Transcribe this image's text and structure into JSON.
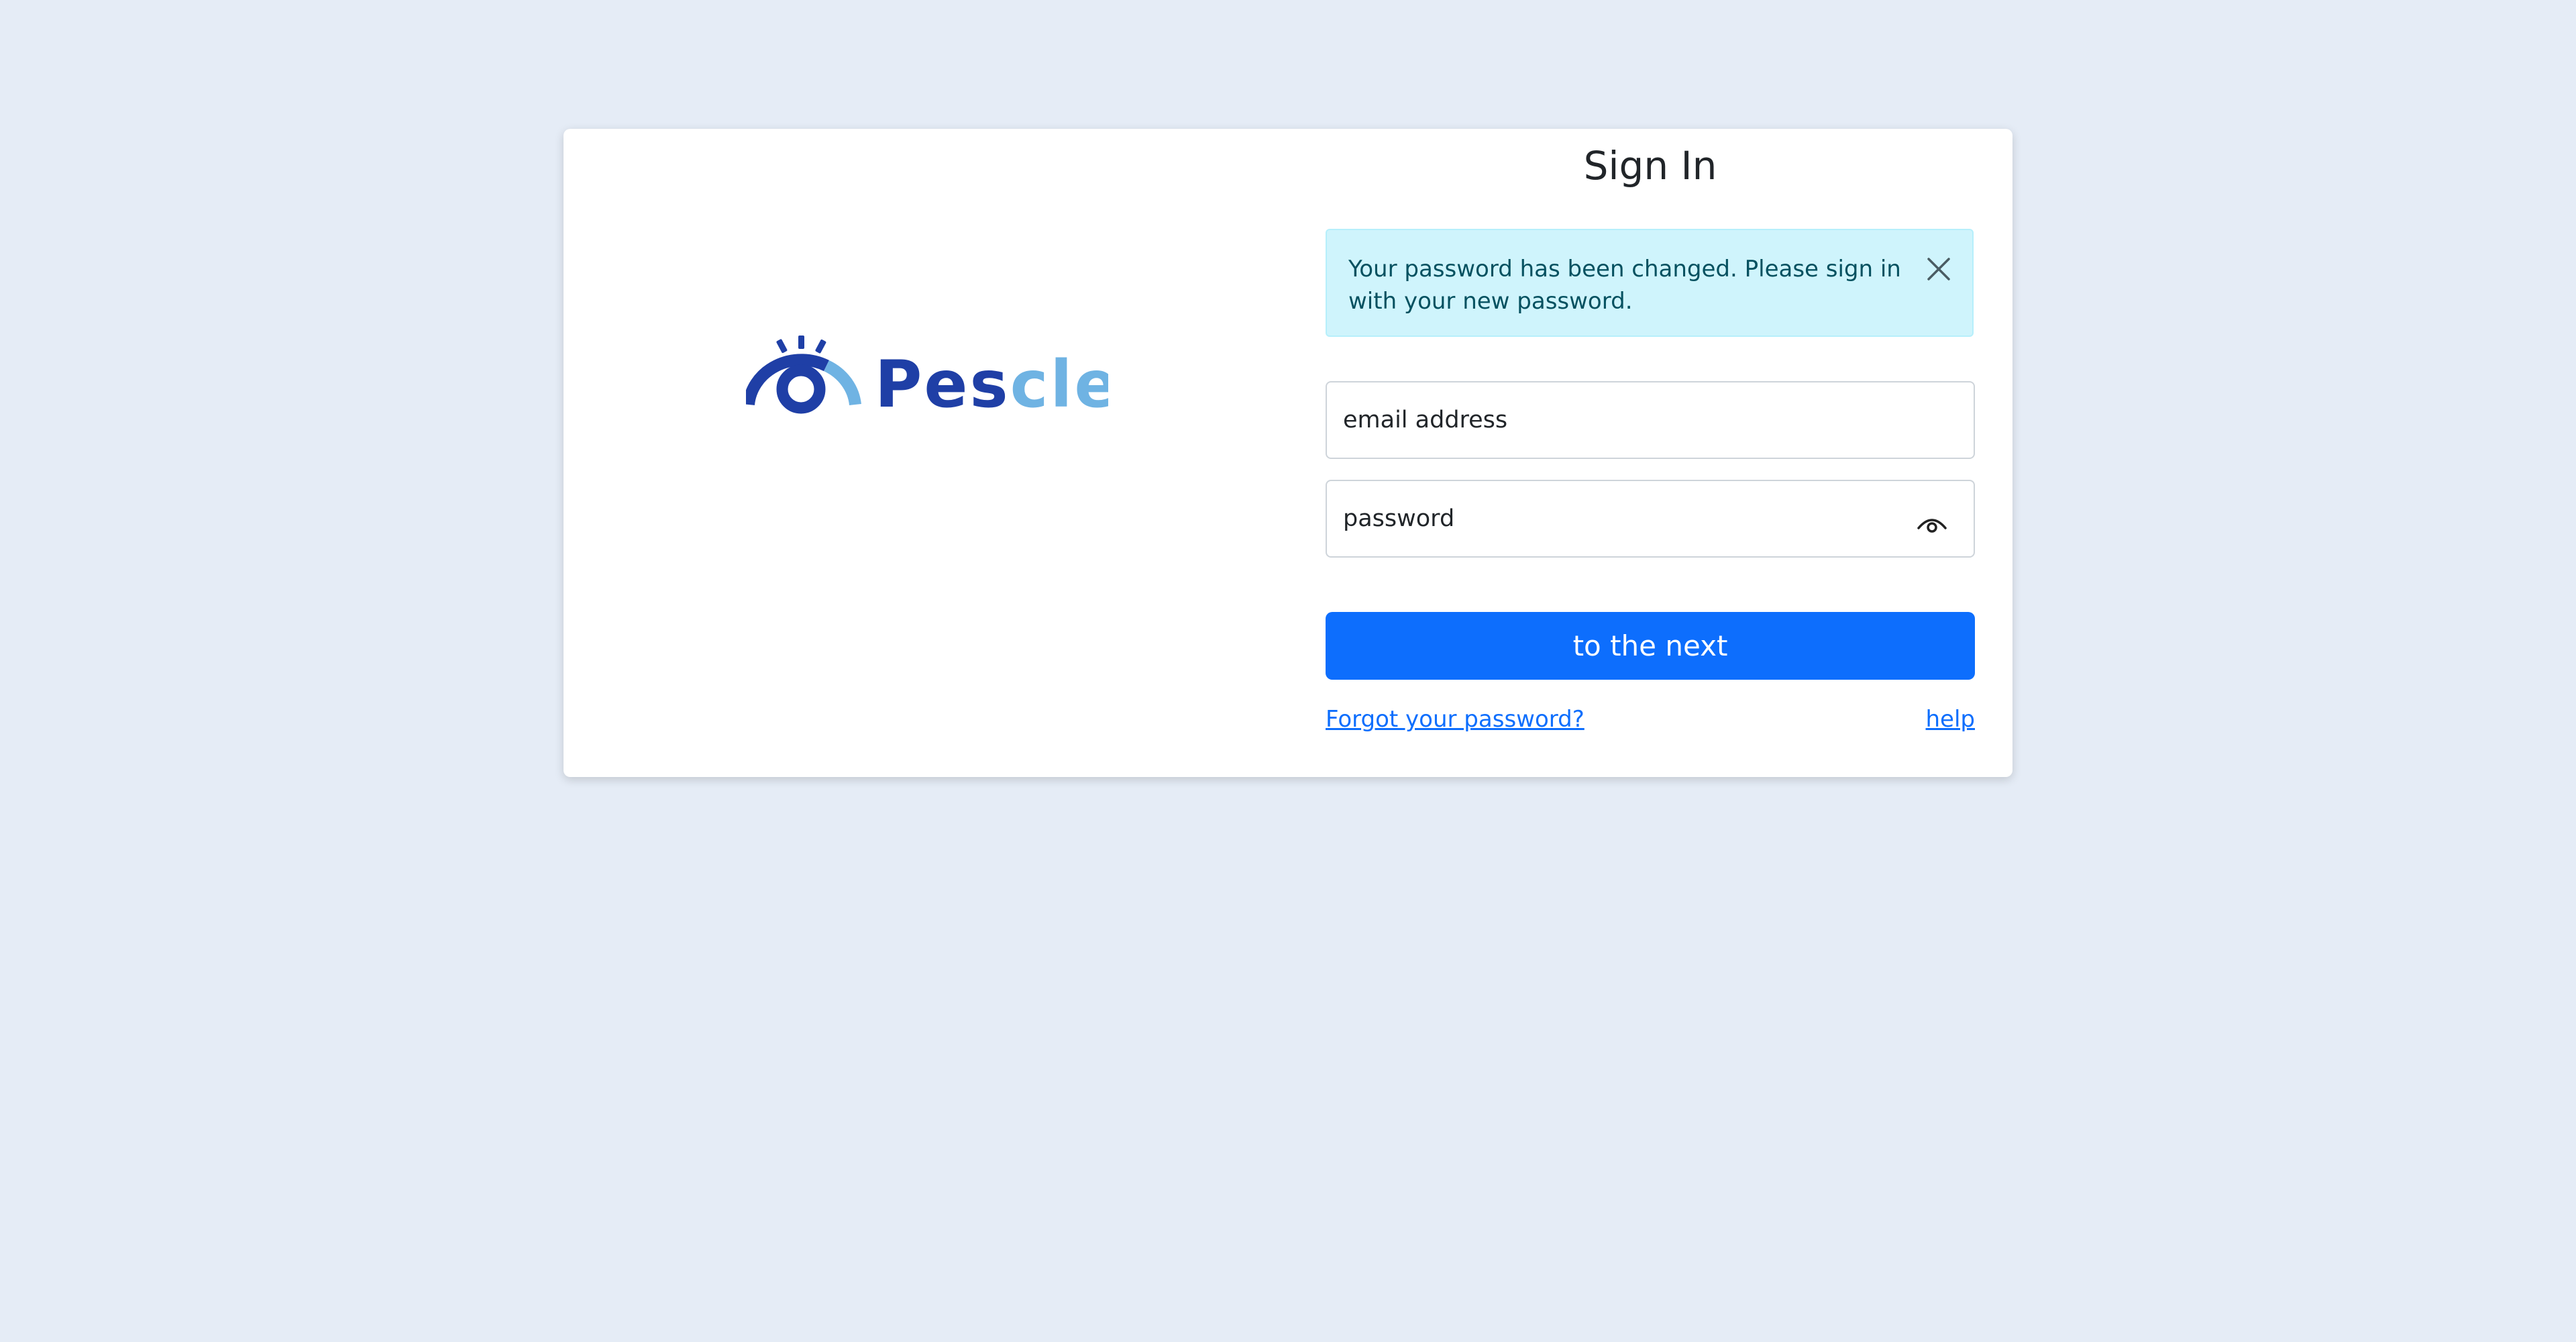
{
  "brand": {
    "name": "Pescle",
    "name_dark_part": "Pes",
    "name_light_part": "cle",
    "dark_color": "#1f3fa6",
    "light_color": "#6fb3e3"
  },
  "signin": {
    "title": "Sign In",
    "alert_message": "Your password has been changed. Please sign in with your new password.",
    "email_placeholder": "email address",
    "password_placeholder": "password",
    "submit_label": "to the next",
    "forgot_link": "Forgot your password?",
    "help_link": "help"
  },
  "icons": {
    "close": "close-icon",
    "show_password": "eye-icon"
  },
  "colors": {
    "background": "#e5ecf6",
    "primary": "#0d6efd",
    "alert_bg": "#cff4fc",
    "alert_text": "#055160"
  }
}
